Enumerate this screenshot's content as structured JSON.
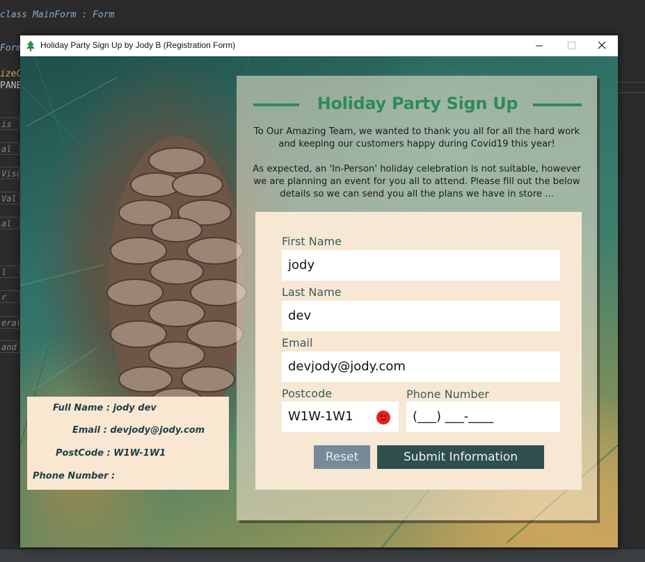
{
  "ide": {
    "code_line": "class MainForm : Form",
    "fragments": [
      "Form",
      "izeC",
      "PANE",
      "is",
      "al S",
      "Visu",
      "Val",
      "al",
      "l",
      "r Va",
      "erat",
      "and"
    ]
  },
  "window": {
    "title": "Holiday Party Sign Up by Jody B (Registration Form)",
    "icon": "christmas-tree-icon"
  },
  "panel": {
    "heading": "Holiday Party Sign Up",
    "intro_1": "To Our Amazing Team, we wanted to thank you all for all the hard work and keeping our customers happy during Covid19 this year!",
    "intro_2": "As expected, an 'In-Person' holiday celebration is not suitable, however we are planning an event for you all to attend. Please fill out the below details so we can send you all the plans we have in store ..."
  },
  "form": {
    "first_name_label": "First Name",
    "first_name_value": "jody",
    "last_name_label": "Last Name",
    "last_name_value": "dev",
    "email_label": "Email",
    "email_value": "devjody@jody.com",
    "postcode_label": "Postcode",
    "postcode_value": "W1W-1W1",
    "postcode_error_icon": "error-icon",
    "phone_label": "Phone Number",
    "phone_value": "(___) ___-____",
    "reset_label": "Reset",
    "submit_label": "Submit Information"
  },
  "summary": {
    "full_name": "Full Name : jody dev",
    "email": "Email : devjody@jody.com",
    "postcode": "PostCode : W1W-1W1",
    "phone": "Phone Number :"
  },
  "colors": {
    "accent": "#2e8b57",
    "submit_bg": "#2f4f4f",
    "reset_bg": "#778899",
    "error": "#e02424"
  }
}
